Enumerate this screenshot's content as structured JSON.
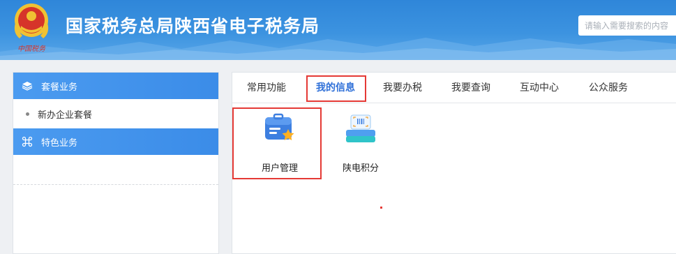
{
  "header": {
    "title": "国家税务总局陕西省电子税务局",
    "search_placeholder": "请输入需要搜索的内容",
    "emblem_icon": "tax-emblem-icon"
  },
  "sidebar": {
    "sections": [
      {
        "label": "套餐业务",
        "icon": "layers-icon",
        "items": [
          {
            "label": "新办企业套餐"
          }
        ]
      },
      {
        "label": "特色业务",
        "icon": "command-icon",
        "items": []
      }
    ]
  },
  "main": {
    "tabs": [
      {
        "label": "常用功能"
      },
      {
        "label": "我的信息",
        "active": true
      },
      {
        "label": "我要办税"
      },
      {
        "label": "我要查询"
      },
      {
        "label": "互动中心"
      },
      {
        "label": "公众服务"
      }
    ],
    "apps": [
      {
        "label": "用户管理",
        "icon": "user-management-icon"
      },
      {
        "label": "陕电积分",
        "icon": "points-icon"
      }
    ]
  },
  "colors": {
    "header_blue": "#3b8ce8",
    "accent_blue": "#2e6fd8",
    "highlight_red": "#e53935"
  }
}
